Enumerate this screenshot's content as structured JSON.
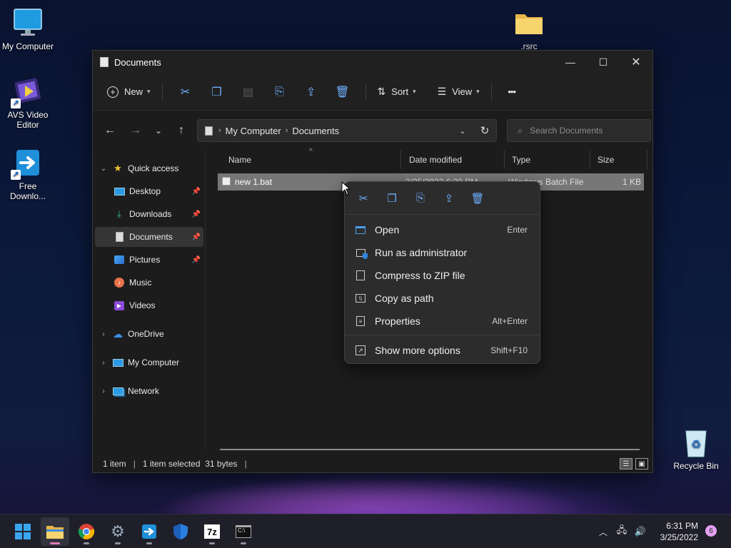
{
  "desktop": {
    "icons": [
      {
        "label": "My Computer"
      },
      {
        "label": "AVS Video Editor"
      },
      {
        "label": "Free Downlo..."
      },
      {
        "label": ".rsrc"
      },
      {
        "label": "Recycle Bin"
      }
    ]
  },
  "window": {
    "title": "Documents",
    "controls": {
      "minimize": "—",
      "maximize": "☐",
      "close": "✕"
    }
  },
  "toolbar": {
    "new_label": "New",
    "sort_label": "Sort",
    "view_label": "View",
    "more_label": "•••"
  },
  "address": {
    "crumbs": [
      "My Computer",
      "Documents"
    ]
  },
  "search": {
    "placeholder": "Search Documents"
  },
  "sidebar": {
    "quick_access": "Quick access",
    "items": [
      {
        "label": "Desktop",
        "pinned": true
      },
      {
        "label": "Downloads",
        "pinned": true
      },
      {
        "label": "Documents",
        "pinned": true,
        "selected": true
      },
      {
        "label": "Pictures",
        "pinned": true
      },
      {
        "label": "Music",
        "pinned": false
      },
      {
        "label": "Videos",
        "pinned": false
      }
    ],
    "onedrive": "OneDrive",
    "my_computer": "My Computer",
    "network": "Network"
  },
  "columns": {
    "name": "Name",
    "date": "Date modified",
    "type": "Type",
    "size": "Size"
  },
  "files": [
    {
      "name": "new 1.bat",
      "date": "3/25/2022 6:30 PM",
      "type": "Windows Batch File",
      "size": "1 KB"
    }
  ],
  "status": {
    "count": "1 item",
    "selected": "1 item selected  31 bytes",
    "sep": "|"
  },
  "context_menu": {
    "items": [
      {
        "label": "Open",
        "shortcut": "Enter"
      },
      {
        "label": "Run as administrator",
        "shortcut": ""
      },
      {
        "label": "Compress to ZIP file",
        "shortcut": ""
      },
      {
        "label": "Copy as path",
        "shortcut": ""
      },
      {
        "label": "Properties",
        "shortcut": "Alt+Enter"
      },
      {
        "label": "Show more options",
        "shortcut": "Shift+F10"
      }
    ]
  },
  "taskbar": {
    "time": "6:31 PM",
    "date": "3/25/2022",
    "notifications": "6"
  },
  "colors": {
    "accent": "#6fb0ff",
    "selection": "#777777",
    "active_indicator": "#e07ab8"
  }
}
